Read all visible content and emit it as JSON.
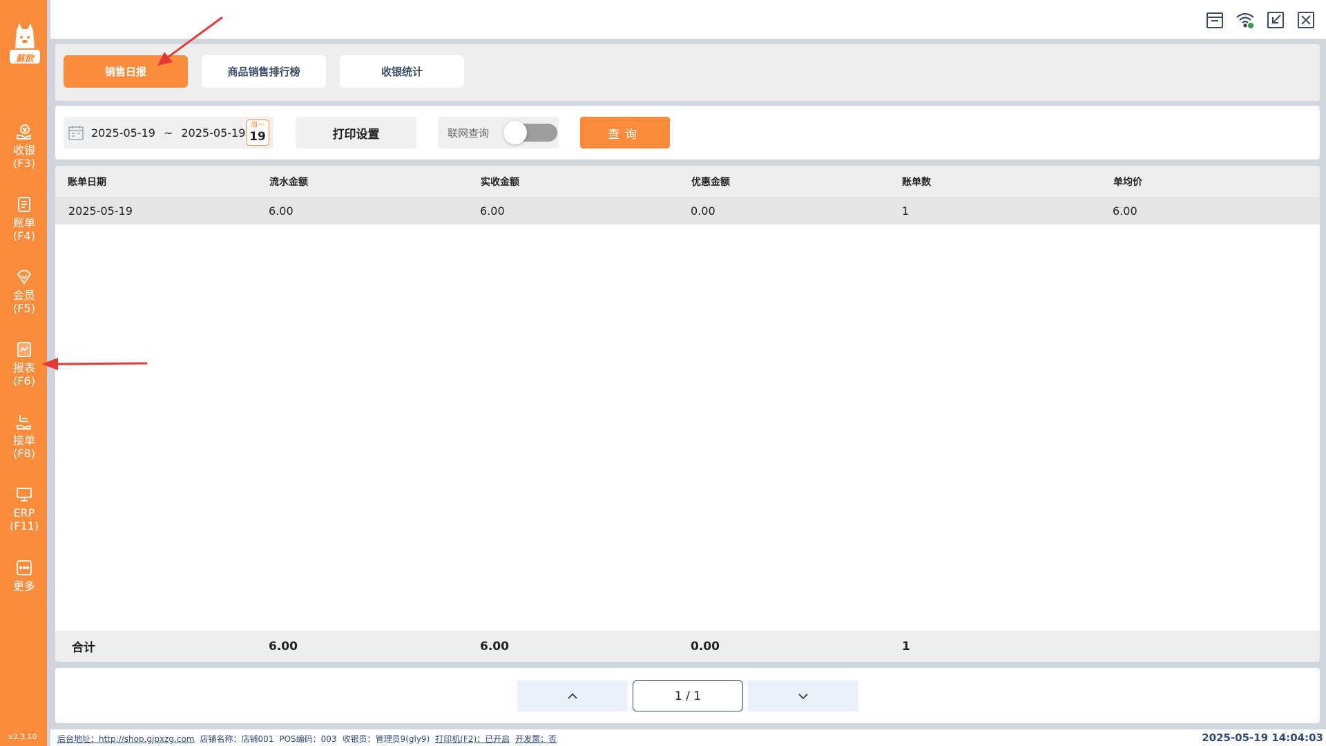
{
  "app": {
    "logo_text": "蘇飲",
    "version": "v3.3.10"
  },
  "colors": {
    "accent": "#fb8c3b",
    "nav_text": "#3a4a64",
    "annotation_arrow": "#e53935"
  },
  "sidebar": {
    "items": [
      {
        "label": "收银",
        "key": "(F3)",
        "icon": "cashier-icon"
      },
      {
        "label": "账单",
        "key": "(F4)",
        "icon": "bill-icon"
      },
      {
        "label": "会员",
        "key": "(F5)",
        "icon": "member-icon"
      },
      {
        "label": "报表",
        "key": "(F6)",
        "icon": "report-icon"
      },
      {
        "label": "接单",
        "key": "(F8)",
        "icon": "order-icon"
      },
      {
        "label": "ERP",
        "key": "(F11)",
        "icon": "erp-icon"
      },
      {
        "label": "更多",
        "key": "",
        "icon": "more-icon"
      }
    ]
  },
  "topbar": {
    "icons": [
      "cashbox-icon",
      "wifi-icon",
      "minimize-icon",
      "close-icon"
    ]
  },
  "tabs": [
    {
      "label": "销售日报",
      "active": true
    },
    {
      "label": "商品销售排行榜",
      "active": false
    },
    {
      "label": "收银统计",
      "active": false
    }
  ],
  "filter": {
    "start_date": "2025-05-19",
    "separator": "~",
    "end_date": "2025-05-19",
    "weekday": "周一",
    "day": "19",
    "print_settings": "打印设置",
    "online_query": "联网查询",
    "online_query_enabled": false,
    "query_button": "查询"
  },
  "table": {
    "columns": [
      "账单日期",
      "流水金额",
      "实收金额",
      "优惠金额",
      "账单数",
      "单均价"
    ],
    "rows": [
      [
        "2025-05-19",
        "6.00",
        "6.00",
        "0.00",
        "1",
        "6.00"
      ]
    ],
    "footer": [
      "合计",
      "6.00",
      "6.00",
      "0.00",
      "1",
      ""
    ]
  },
  "pager": {
    "label": "1 / 1"
  },
  "statusbar": {
    "backend": "后台地址：http://shop.gjpxzg.com",
    "shop": "店铺名称：店铺001",
    "pos": "POS编码：003",
    "cashier": "收银员：管理员9(gly9)",
    "printer": "打印机(F2)：已开启",
    "invoice": "开发票：否",
    "datetime": "2025-05-19 14:04:03"
  }
}
